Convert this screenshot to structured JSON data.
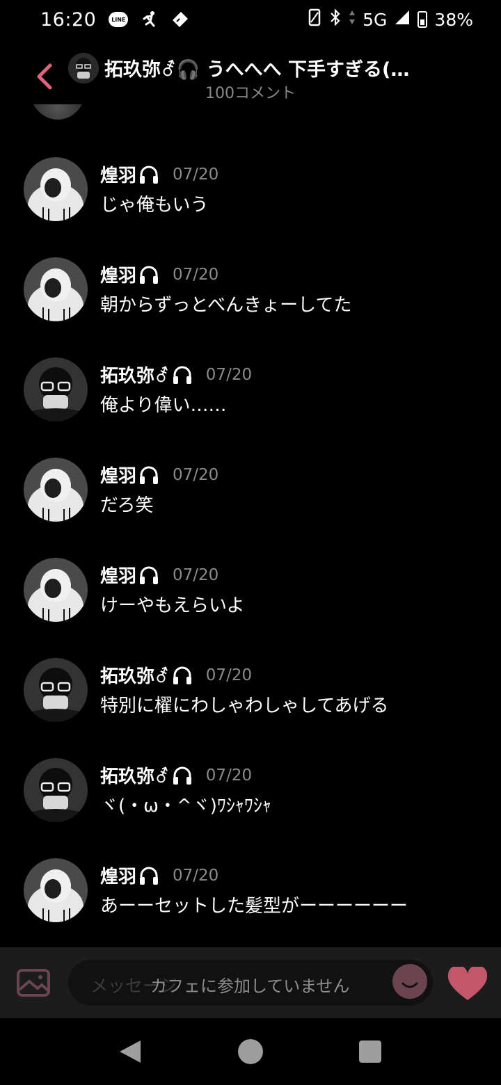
{
  "status_bar": {
    "time": "16:20",
    "line_badge": "LINE",
    "network": "5G",
    "battery": "38%"
  },
  "header": {
    "title": "拓玖弥⚦🎧 うへへへ 下手すぎる(…",
    "subtitle": "100コメント"
  },
  "users": {
    "koha": "煌羽",
    "takumi": "拓玖弥⚦"
  },
  "comments": [
    {
      "user": "煌羽",
      "date": "07/20",
      "text": "じゃ俺もいう"
    },
    {
      "user": "煌羽",
      "date": "07/20",
      "text": "朝からずっとべんきょーしてた"
    },
    {
      "user": "拓玖弥⚦",
      "date": "07/20",
      "text": "俺より偉い……"
    },
    {
      "user": "煌羽",
      "date": "07/20",
      "text": "だろ笑"
    },
    {
      "user": "煌羽",
      "date": "07/20",
      "text": "けーやもえらいよ"
    },
    {
      "user": "拓玖弥⚦",
      "date": "07/20",
      "text": "特別に櫂にわしゃわしゃしてあげる"
    },
    {
      "user": "拓玖弥⚦",
      "date": "07/20",
      "text": "ヾ(・ω・^ヾ)ﾜｼｬﾜｼｬ"
    },
    {
      "user": "煌羽",
      "date": "07/20",
      "text": "あーーセットした髪型がーーーーーー"
    }
  ],
  "composer": {
    "placeholder": "メッセージ",
    "notice": "カフェに参加していません"
  },
  "colors": {
    "accent": "#e0637e",
    "heart": "#c2576c",
    "muted": "#8a8a8a"
  }
}
